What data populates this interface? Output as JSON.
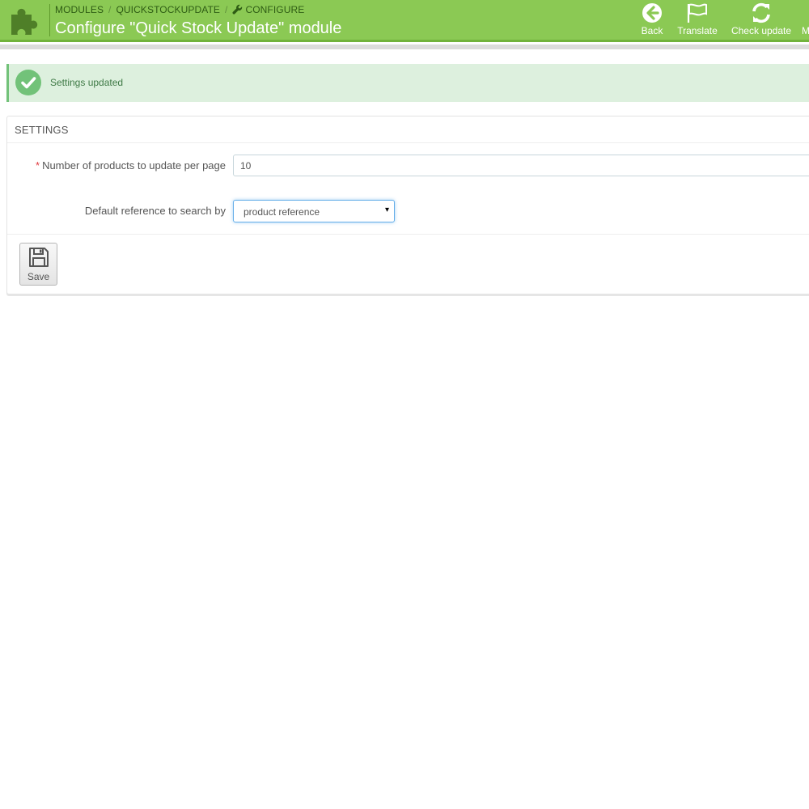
{
  "header": {
    "breadcrumb": {
      "modules": "MODULES",
      "separator": "/",
      "module_name": "QUICKSTOCKUPDATE",
      "configure": "CONFIGURE"
    },
    "title": "Configure \"Quick Stock Update\" module",
    "toolbar": {
      "back_label": "Back",
      "translate_label": "Translate",
      "check_update_label": "Check update",
      "more_label": "M"
    },
    "colors": {
      "bar": "#8bc954",
      "title_text": "#ffffff"
    }
  },
  "alert": {
    "message": "Settings updated",
    "icon": "check-circle-icon",
    "color": "#72c279"
  },
  "settings_panel": {
    "heading": "SETTINGS",
    "products_per_page": {
      "required_mark": "*",
      "label": "Number of products to update per page",
      "value": "10"
    },
    "default_reference": {
      "label": "Default reference to search by",
      "selected": "product reference",
      "caret": "▾"
    },
    "save": {
      "label": "Save",
      "icon": "floppy-disk-icon"
    }
  }
}
